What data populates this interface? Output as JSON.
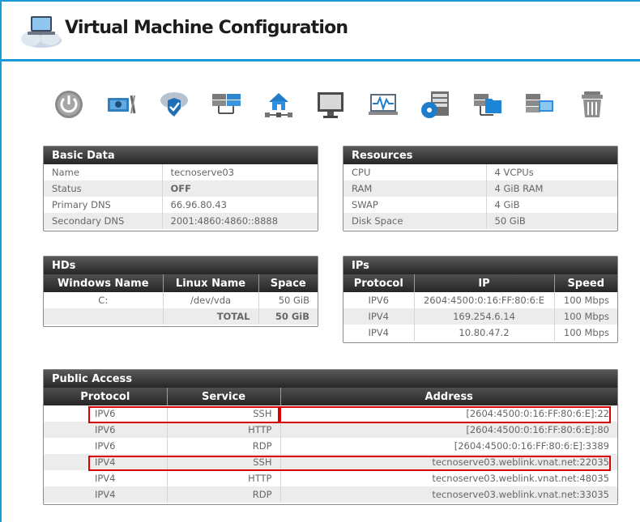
{
  "header": {
    "title": "Virtual Machine Configuration"
  },
  "toolbar": {
    "tools": [
      {
        "name": "power-icon"
      },
      {
        "name": "hardware-tools-icon"
      },
      {
        "name": "cloud-shield-icon"
      },
      {
        "name": "server-network-icon"
      },
      {
        "name": "home-network-icon"
      },
      {
        "name": "monitor-icon"
      },
      {
        "name": "activity-monitor-icon"
      },
      {
        "name": "server-disk-icon"
      },
      {
        "name": "server-folder-icon"
      },
      {
        "name": "server-windows-icon"
      },
      {
        "name": "trash-icon"
      }
    ]
  },
  "basic_data": {
    "title": "Basic Data",
    "rows": [
      {
        "label": "Name",
        "value": "tecnoserve03"
      },
      {
        "label": "Status",
        "value": "OFF"
      },
      {
        "label": "Primary DNS",
        "value": "66.96.80.43"
      },
      {
        "label": "Secondary DNS",
        "value": "2001:4860:4860::8888"
      }
    ]
  },
  "resources": {
    "title": "Resources",
    "rows": [
      {
        "label": "CPU",
        "value": "4 VCPUs"
      },
      {
        "label": "RAM",
        "value": "4 GiB RAM"
      },
      {
        "label": "SWAP",
        "value": "4 GiB"
      },
      {
        "label": "Disk Space",
        "value": "50 GiB"
      }
    ]
  },
  "hds": {
    "title": "HDs",
    "columns": [
      "Windows Name",
      "Linux Name",
      "Space"
    ],
    "rows": [
      {
        "win": "C:",
        "linux": "/dev/vda",
        "space": "50 GiB"
      }
    ],
    "total_label": "TOTAL",
    "total_value": "50 GiB"
  },
  "ips": {
    "title": "IPs",
    "columns": [
      "Protocol",
      "IP",
      "Speed"
    ],
    "rows": [
      {
        "protocol": "IPV6",
        "ip": "2604:4500:0:16:FF:80:6:E",
        "speed": "100 Mbps"
      },
      {
        "protocol": "IPV4",
        "ip": "169.254.6.14",
        "speed": "100 Mbps"
      },
      {
        "protocol": "IPV4",
        "ip": "10.80.47.2",
        "speed": "100 Mbps"
      }
    ]
  },
  "public_access": {
    "title": "Public Access",
    "columns": [
      "Protocol",
      "Service",
      "Address"
    ],
    "rows": [
      {
        "protocol": "IPV6",
        "service": "SSH",
        "address": "[2604:4500:0:16:FF:80:6:E]:22"
      },
      {
        "protocol": "IPV6",
        "service": "HTTP",
        "address": "[2604:4500:0:16:FF:80:6:E]:80"
      },
      {
        "protocol": "IPV6",
        "service": "RDP",
        "address": "[2604:4500:0:16:FF:80:6:E]:3389"
      },
      {
        "protocol": "IPV4",
        "service": "SSH",
        "address": "tecnoserve03.weblink.vnat.net:22035"
      },
      {
        "protocol": "IPV4",
        "service": "HTTP",
        "address": "tecnoserve03.weblink.vnat.net:48035"
      },
      {
        "protocol": "IPV4",
        "service": "RDP",
        "address": "tecnoserve03.weblink.vnat.net:33035"
      }
    ]
  },
  "colors": {
    "accent": "#1a9ad6",
    "highlight": "#d80000",
    "header_dark": "#262626"
  }
}
